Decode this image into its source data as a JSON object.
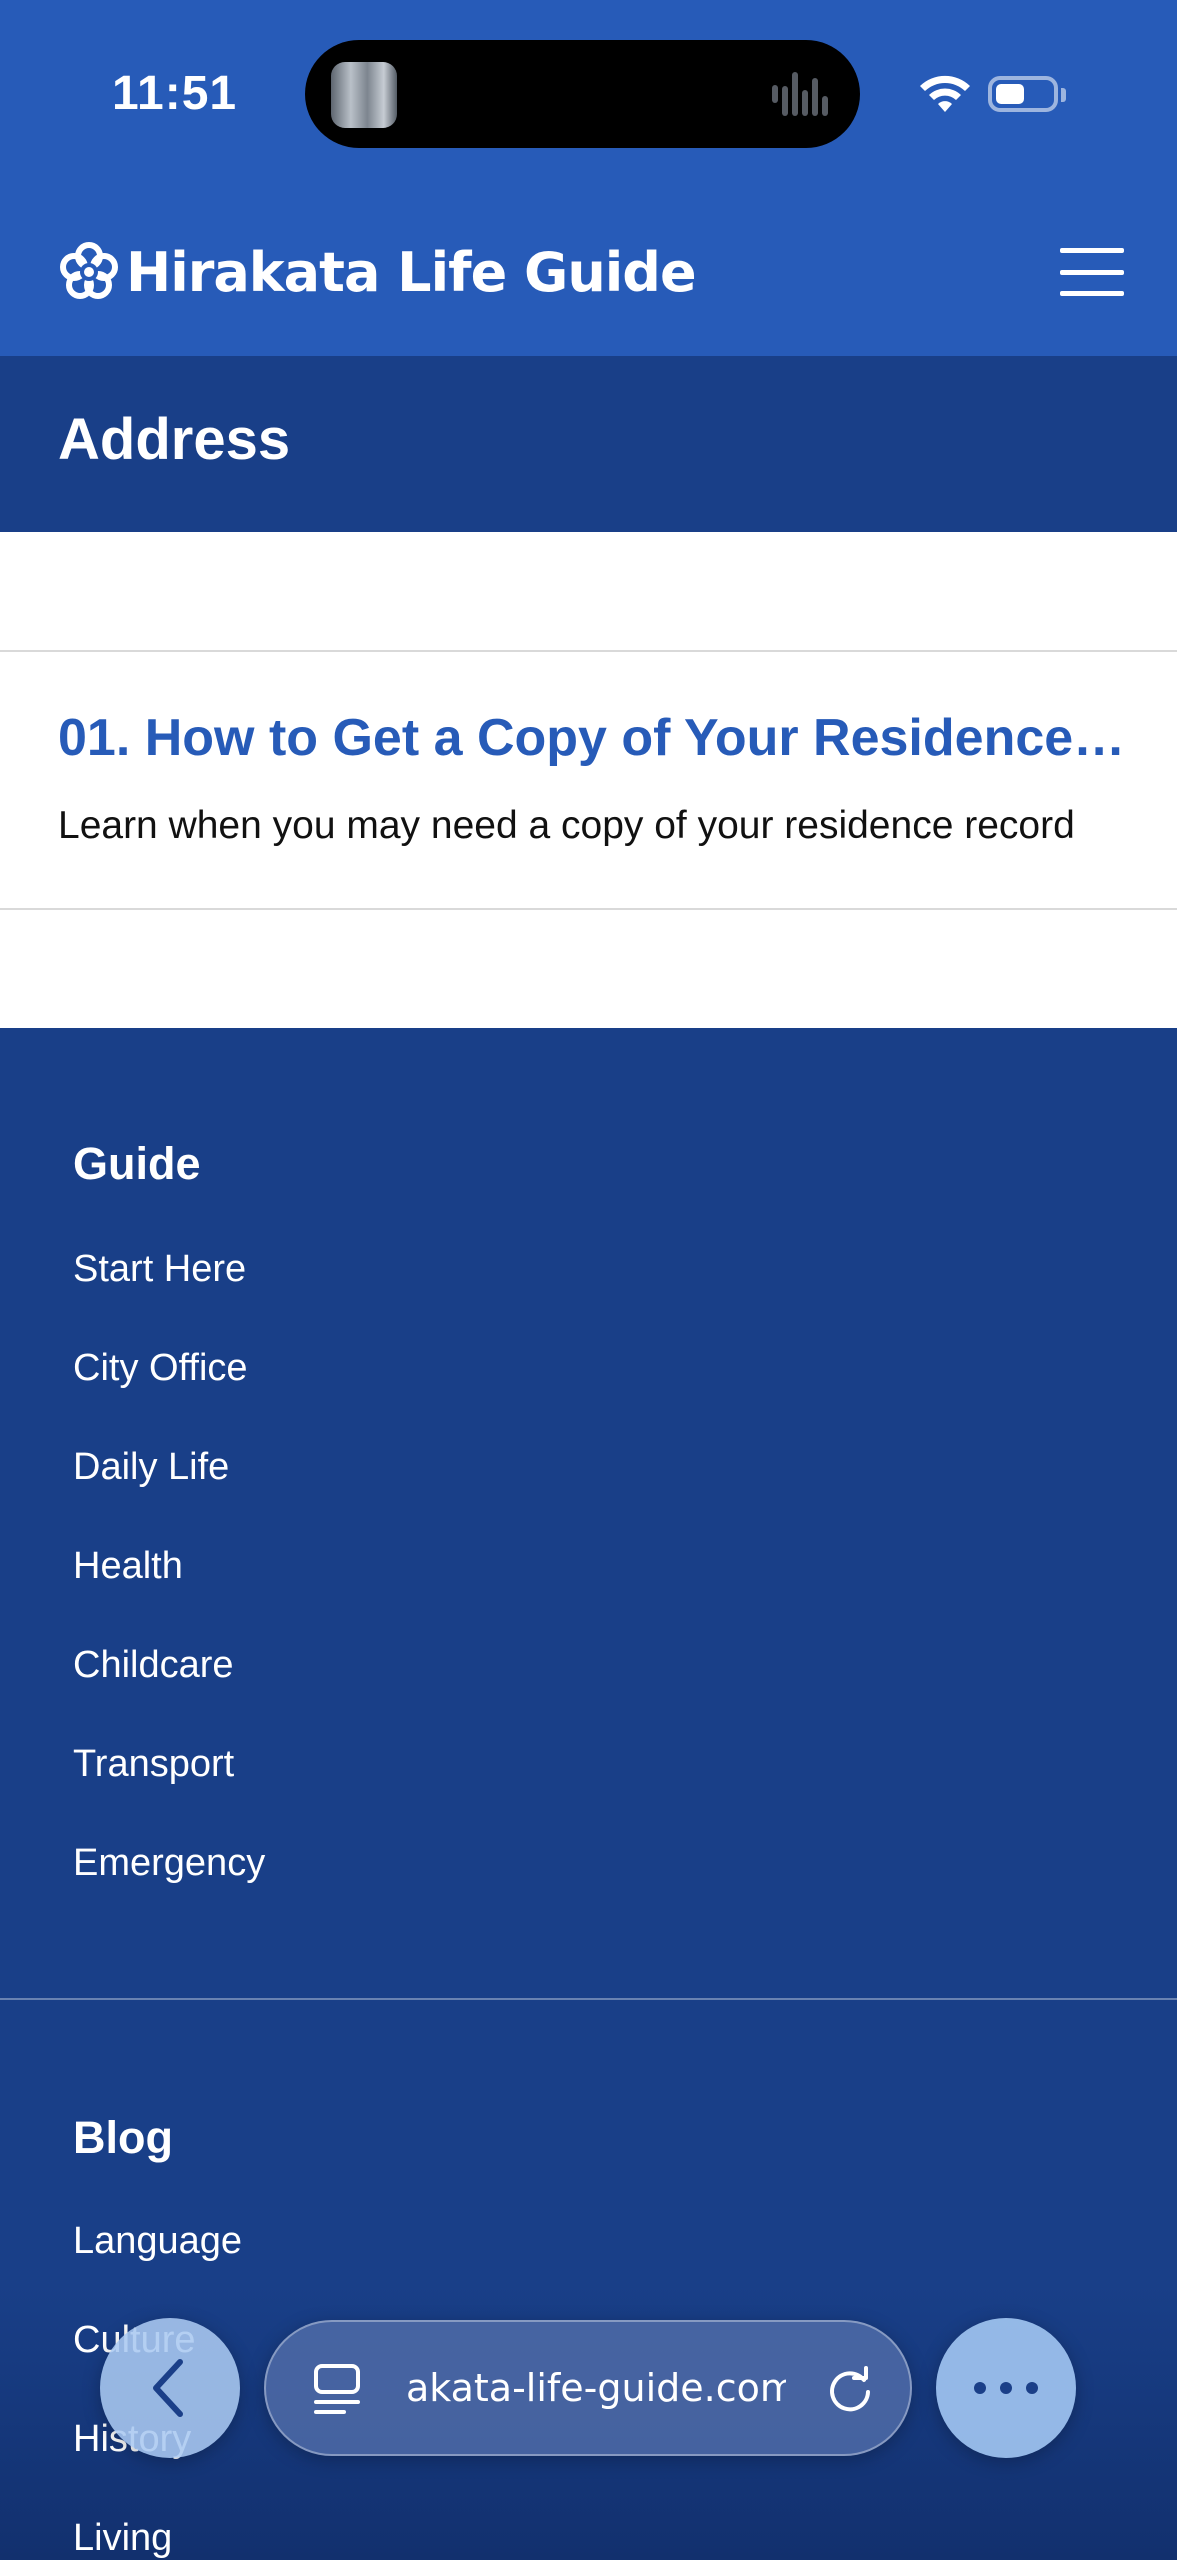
{
  "status_bar": {
    "time": "11:51"
  },
  "header": {
    "site_title": "Hirakata Life Guide",
    "logo_icon": "flower-icon",
    "menu_icon": "hamburger-icon"
  },
  "page": {
    "title": "Address"
  },
  "articles": [
    {
      "title": "01. How to Get a Copy of Your Residence Record",
      "excerpt": "Learn when you may need a copy of your residence record"
    }
  ],
  "footer": {
    "guide": {
      "heading": "Guide",
      "links": [
        "Start Here",
        "City Office",
        "Daily Life",
        "Health",
        "Childcare",
        "Transport",
        "Emergency"
      ]
    },
    "blog": {
      "heading": "Blog",
      "links": [
        "Language",
        "Culture",
        "History",
        "Living"
      ]
    }
  },
  "browser": {
    "url": "akata-life-guide.com",
    "back_icon": "chevron-left-icon",
    "tabs_icon": "tabs-icon",
    "reload_icon": "reload-icon",
    "more_icon": "more-dots-icon"
  },
  "colors": {
    "header_blue": "#275bb8",
    "dark_blue": "#193f88",
    "link_blue": "#275bb8"
  }
}
